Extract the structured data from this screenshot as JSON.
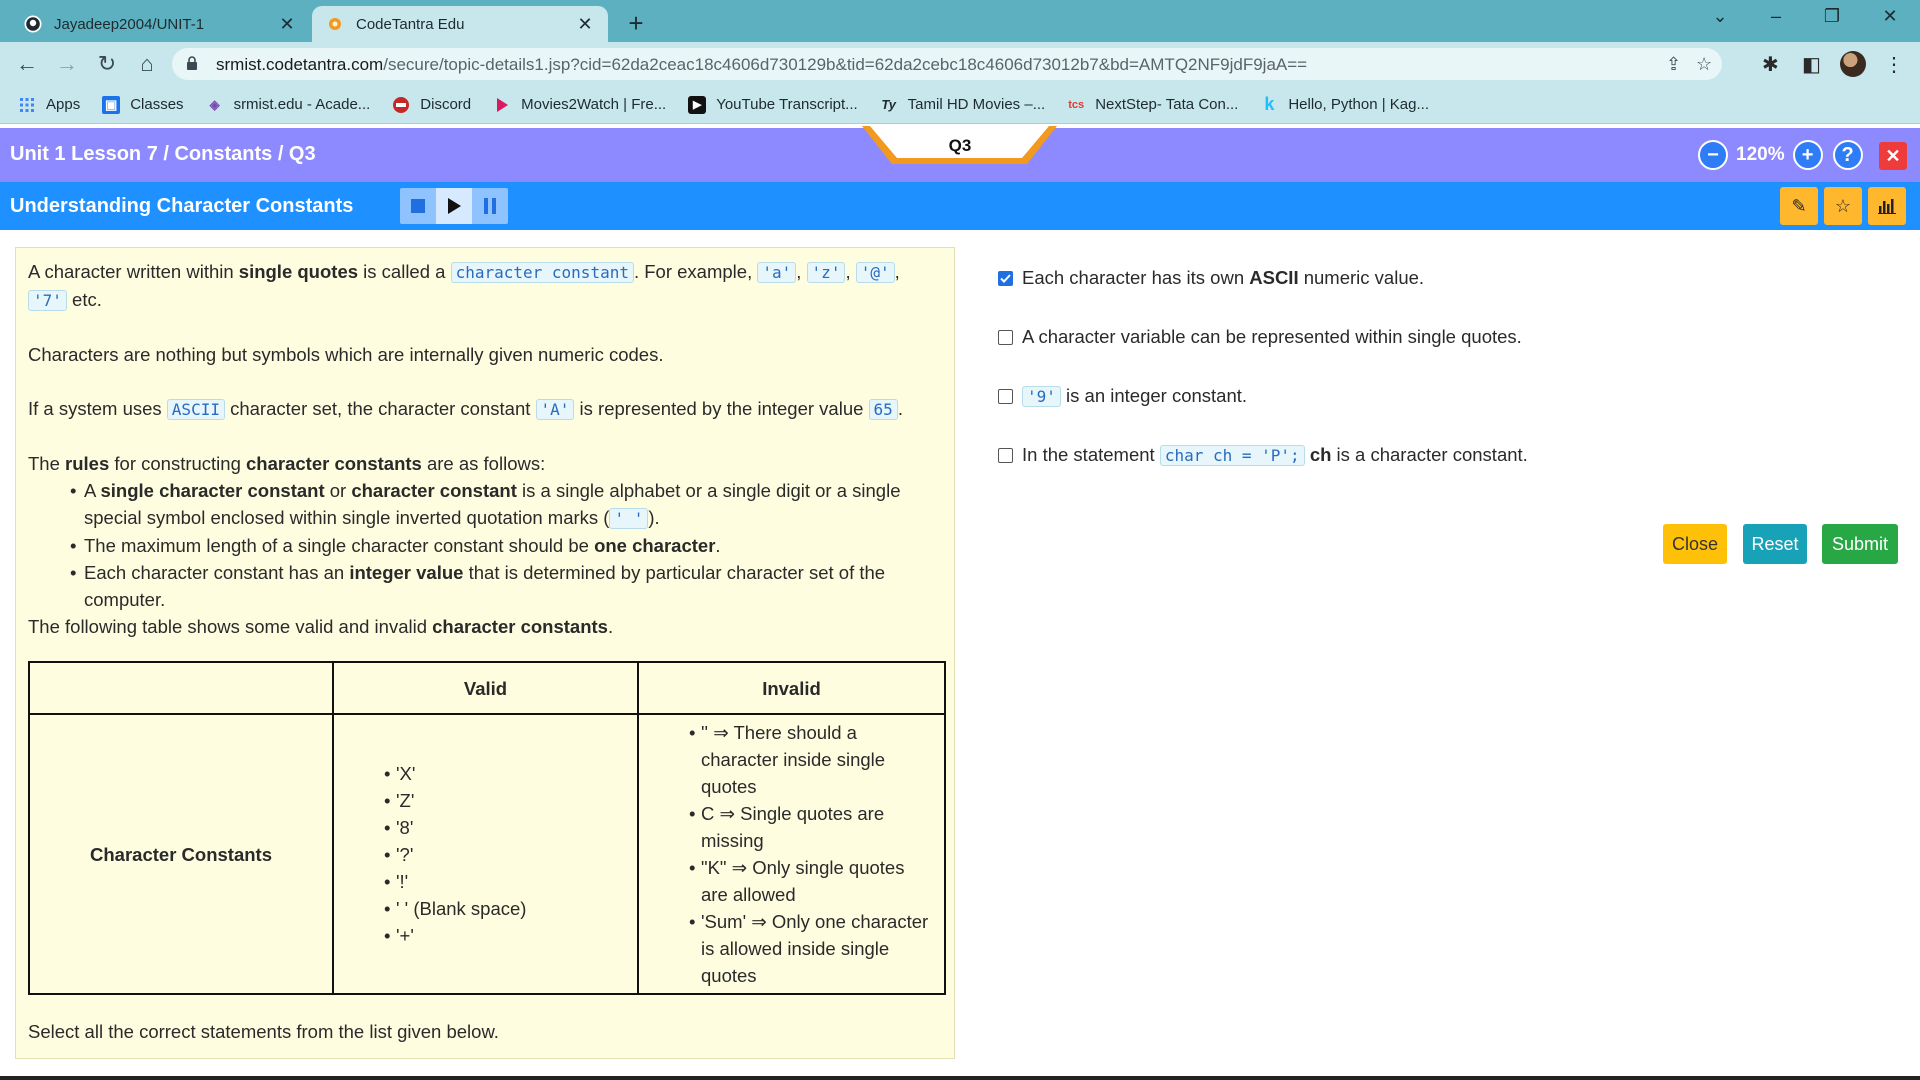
{
  "browser": {
    "tabs": [
      {
        "title": "Jayadeep2004/UNIT-1",
        "icon": "github-icon",
        "active": false
      },
      {
        "title": "CodeTantra Edu",
        "icon": "codetantra-icon",
        "active": true
      }
    ],
    "url_host": "srmist.codetantra.com",
    "url_path": "/secure/topic-details1.jsp?cid=62da2ceac18c4606d730129b&tid=62da2cebc18c4606d73012b7&bd=AMTQ2NF9jdF9jaA==",
    "bookmarks": [
      {
        "label": "Apps",
        "icon": "apps-grid-icon",
        "color": "#4285f4"
      },
      {
        "label": "Classes",
        "icon": "classes-icon",
        "color": "#1a73e8"
      },
      {
        "label": "srmist.edu - Acade...",
        "icon": "srmist-icon",
        "color": "#7a4bb0"
      },
      {
        "label": "Discord",
        "icon": "discord-icon",
        "color": "#c62828"
      },
      {
        "label": "Movies2Watch | Fre...",
        "icon": "play-icon",
        "color": "#d81b60"
      },
      {
        "label": "YouTube Transcript...",
        "icon": "youtube-transcript-icon",
        "color": "#111111"
      },
      {
        "label": "Tamil HD Movies –...",
        "icon": "ty-icon",
        "color": "#333333"
      },
      {
        "label": "NextStep- Tata Con...",
        "icon": "tcs-icon",
        "color": "#e53935"
      },
      {
        "label": "Hello, Python | Kag...",
        "icon": "kaggle-icon",
        "color": "#20beff"
      }
    ]
  },
  "header": {
    "breadcrumb": "Unit 1 Lesson 7 / Constants / Q3",
    "question_tab": "Q3",
    "zoom": "120%",
    "lesson_title": "Understanding Character Constants"
  },
  "content": {
    "p1_a": "A character written within ",
    "p1_b": "single quotes",
    "p1_c": " is called a ",
    "p1_code": "character constant",
    "p1_d": ". For example, ",
    "ex1": "'a'",
    "ex2": "'z'",
    "ex3": "'@'",
    "ex4": "'7'",
    "p1_e": " etc.",
    "p2": "Characters are nothing but symbols which are internally given numeric codes.",
    "p3_a": "If a system uses ",
    "p3_code1": "ASCII",
    "p3_b": " character set, the character constant ",
    "p3_code2": "'A'",
    "p3_c": " is represented by the integer value ",
    "p3_code3": "65",
    "p3_d": ".",
    "p4_a": "The ",
    "p4_b": "rules",
    "p4_c": " for constructing ",
    "p4_d": "character constants",
    "p4_e": " are as follows:",
    "r1_a": "A ",
    "r1_b": "single character constant",
    "r1_c": " or ",
    "r1_d": "character constant",
    "r1_e": " is a single alphabet or a single digit or a single special symbol enclosed within single inverted quotation marks (",
    "r1_code": "' '",
    "r1_f": ").",
    "r2_a": "The maximum length of a single character constant should be ",
    "r2_b": "one character",
    "r2_c": ".",
    "r3_a": "Each character constant has an ",
    "r3_b": "integer value",
    "r3_c": " that is determined by particular character set of the computer.",
    "p5_a": "The following table shows some valid and invalid ",
    "p5_b": "character constants",
    "p5_c": ".",
    "table": {
      "col_valid": "Valid",
      "col_invalid": "Invalid",
      "row_label": "Character Constants",
      "valid": [
        "'X'",
        "'Z'",
        "'8'",
        "'?'",
        "'!'",
        "' ' (Blank space)",
        "'+'"
      ],
      "invalid": [
        "'' ⇒ There should a character inside single quotes",
        "C ⇒ Single quotes are missing",
        "\"K\" ⇒ Only single quotes are allowed",
        "'Sum' ⇒ Only one character is allowed inside single quotes"
      ]
    },
    "footnote": "Select all the correct statements from the list given below."
  },
  "options": {
    "o1_a": "Each character has its own ",
    "o1_b": "ASCII",
    "o1_c": " numeric value.",
    "o1_checked": true,
    "o2": "A character variable can be represented within single quotes.",
    "o3_code": "'9'",
    "o3_b": " is an integer constant.",
    "o4_a": "In the statement ",
    "o4_code": "char ch = 'P';",
    "o4_b": "ch",
    "o4_c": " is a character constant."
  },
  "actions": {
    "close": "Close",
    "reset": "Reset",
    "submit": "Submit"
  },
  "colors": {
    "purple_bar": "#8d8aff",
    "blue_bar": "#1e90ff",
    "close_btn": "#ffc107",
    "reset_btn": "#17a2b8",
    "submit_btn": "#28a745"
  }
}
